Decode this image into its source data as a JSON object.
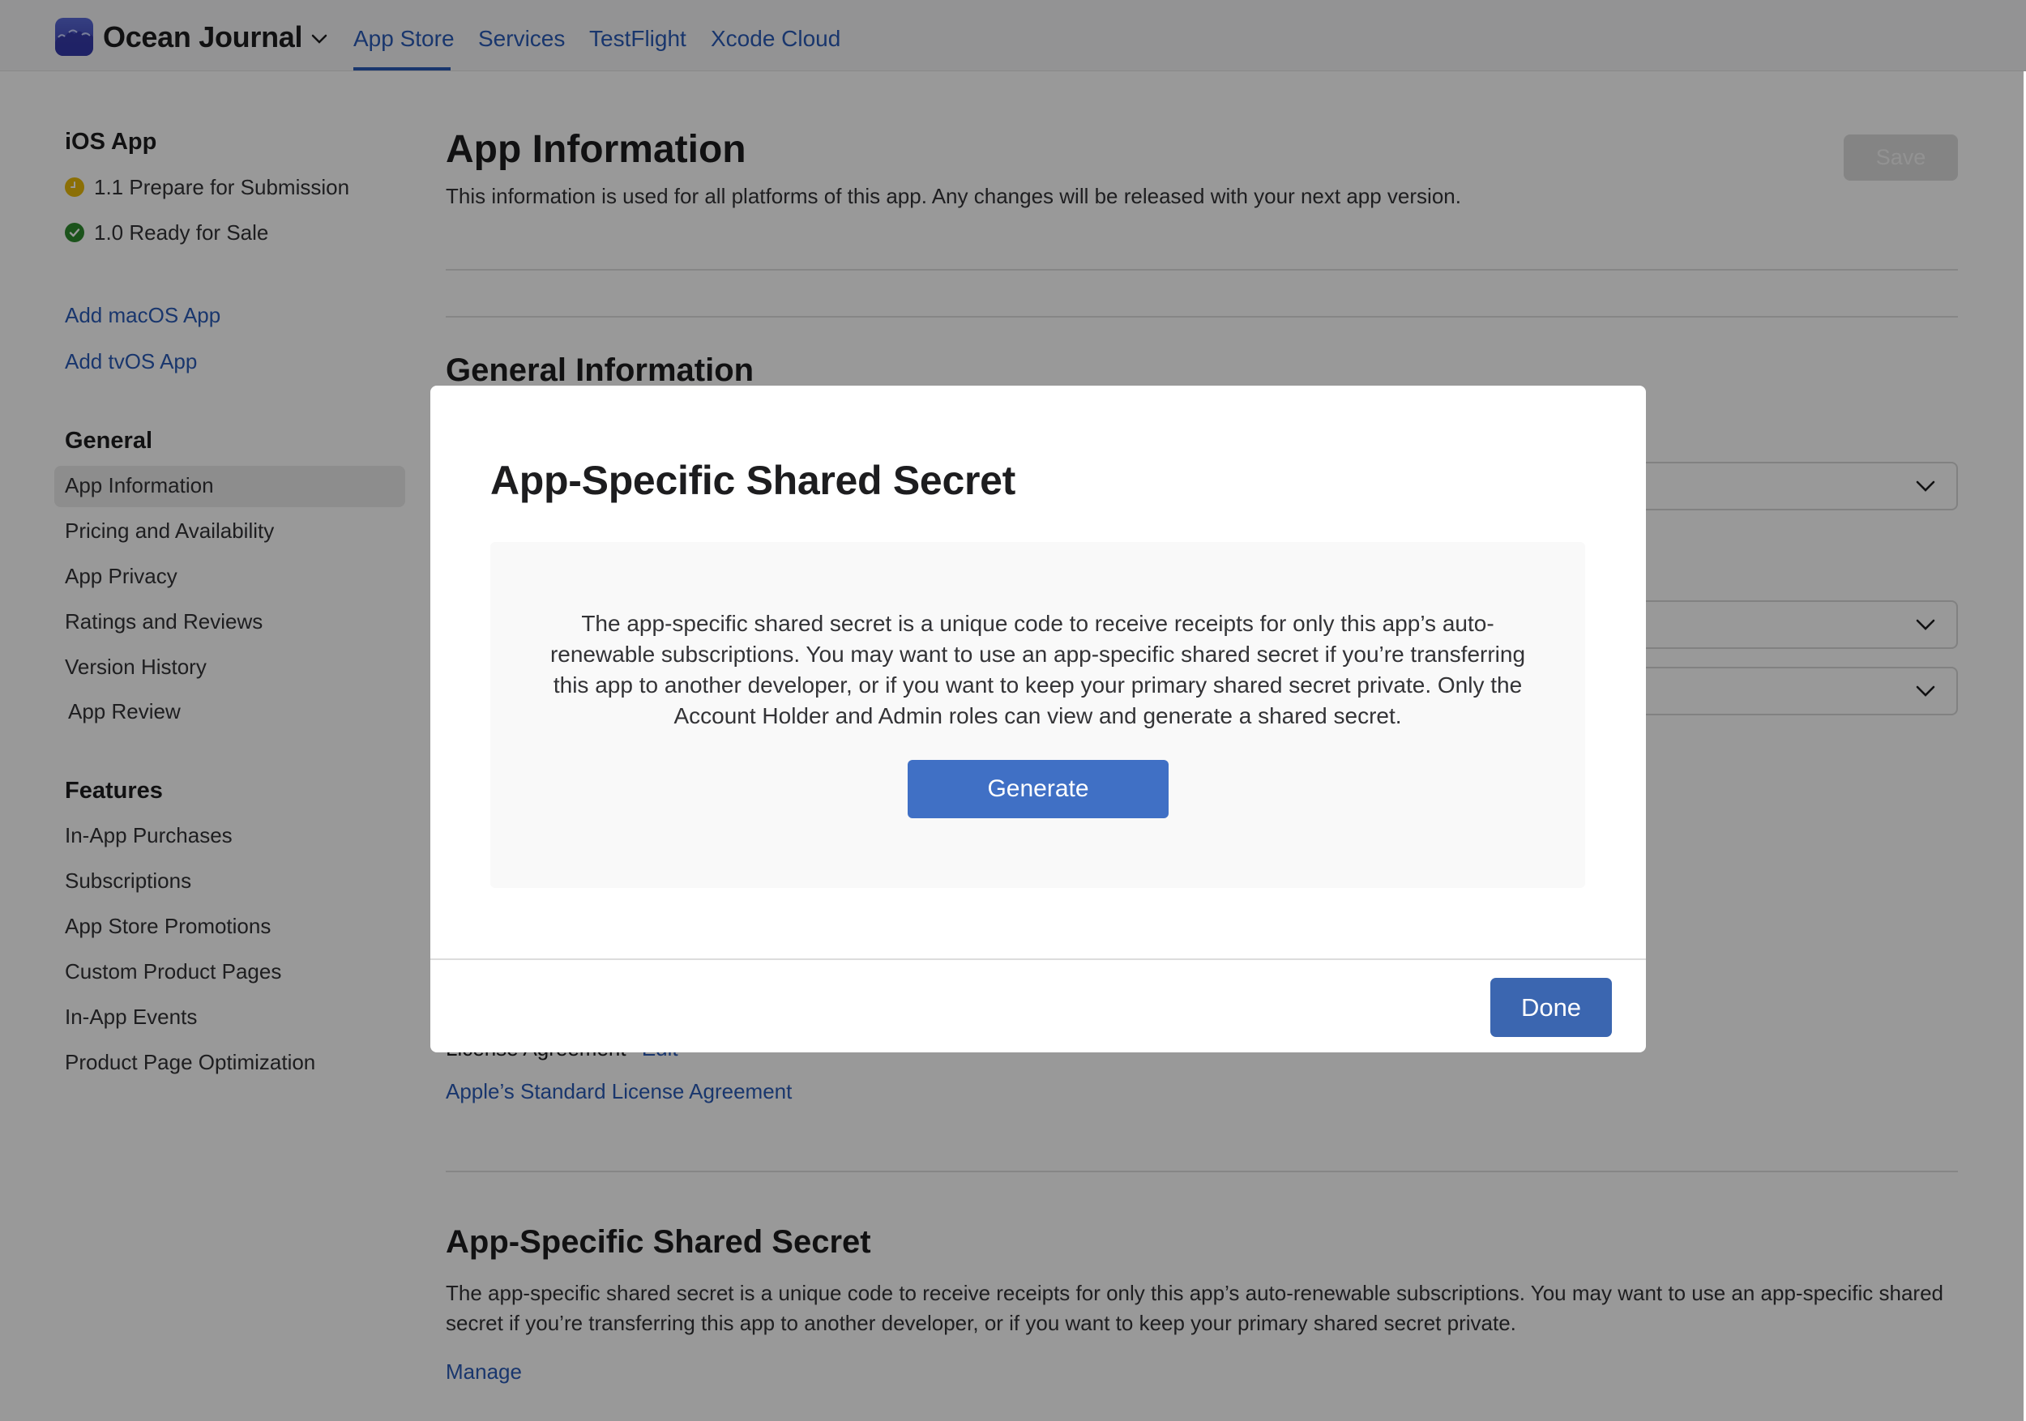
{
  "header": {
    "app_name": "Ocean Journal",
    "app_icon": "wave-app-icon",
    "tabs": [
      {
        "label": "App Store",
        "active": true
      },
      {
        "label": "Services",
        "active": false
      },
      {
        "label": "TestFlight",
        "active": false
      },
      {
        "label": "Xcode Cloud",
        "active": false
      }
    ],
    "accent_color": "#2a5bb6"
  },
  "sidebar": {
    "platform_heading": "iOS App",
    "versions": [
      {
        "label": "1.1 Prepare for Submission",
        "status": "pending",
        "icon": "clock-icon",
        "color": "#e8b90b"
      },
      {
        "label": "1.0 Ready for Sale",
        "status": "ready",
        "icon": "checkmark-icon",
        "color": "#2e8a2e"
      }
    ],
    "add_links": [
      "Add macOS App",
      "Add tvOS App"
    ],
    "general_heading": "General",
    "general_items": [
      {
        "label": "App Information",
        "selected": true
      },
      {
        "label": "Pricing and Availability",
        "selected": false
      },
      {
        "label": "App Privacy",
        "selected": false
      },
      {
        "label": "Ratings and Reviews",
        "selected": false
      },
      {
        "label": "Version History",
        "selected": false
      },
      {
        "label": "App Review",
        "selected": false
      }
    ],
    "features_heading": "Features",
    "features_items": [
      {
        "label": "In-App Purchases"
      },
      {
        "label": "Subscriptions"
      },
      {
        "label": "App Store Promotions"
      },
      {
        "label": "Custom Product Pages"
      },
      {
        "label": "In-App Events"
      },
      {
        "label": "Product Page Optimization"
      }
    ]
  },
  "main": {
    "title": "App Information",
    "subtitle": "This information is used for all platforms of this app. Any changes will be released with your next app version.",
    "save_label": "Save",
    "general_info_heading": "General Information",
    "license_label": "License Agreement",
    "license_edit": "Edit",
    "license_link": "Apple’s Standard License Agreement",
    "secret_heading": "App-Specific Shared Secret",
    "secret_text": "The app-specific shared secret is a unique code to receive receipts for only this app’s auto-renewable subscriptions. You may want to use an app-specific shared secret if you’re transferring this app to another developer, or if you want to keep your primary shared secret private.",
    "manage_link": "Manage"
  },
  "modal": {
    "title": "App-Specific Shared Secret",
    "body": "The app-specific shared secret is a unique code to receive receipts for only this app’s auto-renewable subscriptions. You may want to use an app-specific shared secret if you’re transferring this app to another developer, or if you want to keep your primary shared secret private. Only the Account Holder and Admin roles can view and generate a shared secret.",
    "generate_label": "Generate",
    "done_label": "Done",
    "button_color": "#4070c5",
    "done_color": "#3b66b0"
  }
}
